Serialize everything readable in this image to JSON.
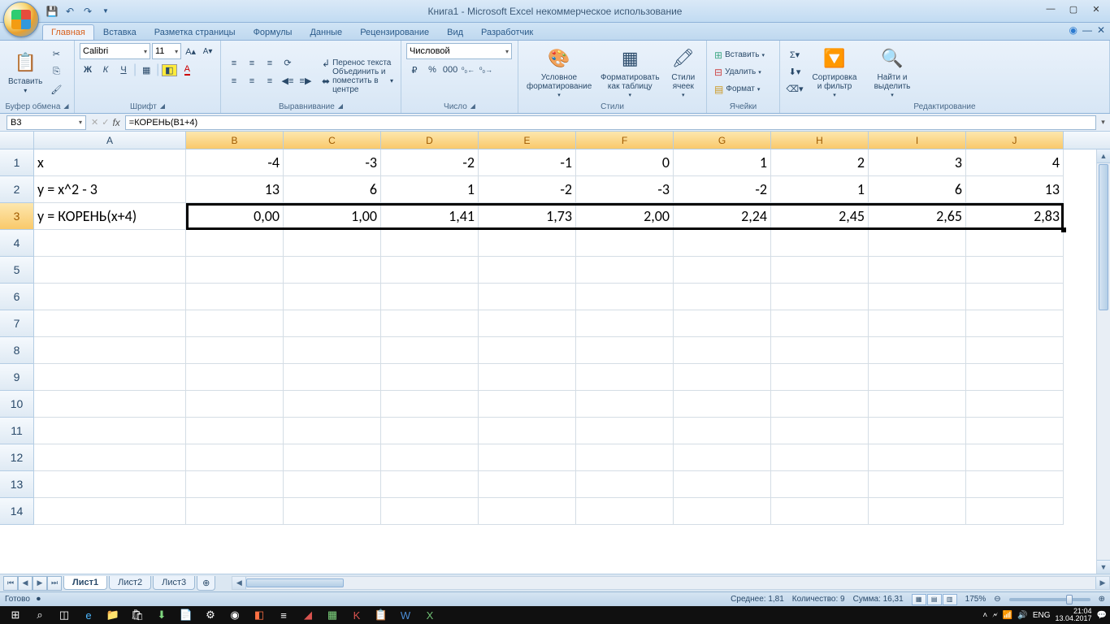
{
  "title": "Книга1 - Microsoft Excel некоммерческое использование",
  "ribbon": {
    "tabs": [
      "Главная",
      "Вставка",
      "Разметка страницы",
      "Формулы",
      "Данные",
      "Рецензирование",
      "Вид",
      "Разработчик"
    ],
    "active_tab": "Главная",
    "clipboard": {
      "label": "Буфер обмена",
      "paste": "Вставить"
    },
    "font": {
      "label": "Шрифт",
      "name": "Calibri",
      "size": "11",
      "bold": "Ж",
      "italic": "К",
      "underline": "Ч"
    },
    "alignment": {
      "label": "Выравнивание",
      "wrap": "Перенос текста",
      "merge": "Объединить и поместить в центре"
    },
    "number": {
      "label": "Число",
      "format": "Числовой"
    },
    "styles": {
      "label": "Стили",
      "cond": "Условное форматирование",
      "table": "Форматировать как таблицу",
      "cell": "Стили ячеек"
    },
    "cells": {
      "label": "Ячейки",
      "insert": "Вставить",
      "delete": "Удалить",
      "format": "Формат"
    },
    "editing": {
      "label": "Редактирование",
      "sort": "Сортировка и фильтр",
      "find": "Найти и выделить"
    }
  },
  "formula_bar": {
    "name_box": "B3",
    "formula": "=КОРЕНЬ(B1+4)"
  },
  "columns": [
    "A",
    "B",
    "C",
    "D",
    "E",
    "F",
    "G",
    "H",
    "I",
    "J"
  ],
  "row_numbers": [
    "1",
    "2",
    "3",
    "4",
    "5",
    "6",
    "7",
    "8",
    "9",
    "10",
    "11",
    "12",
    "13",
    "14"
  ],
  "grid": {
    "r1": {
      "A": "x",
      "B": "-4",
      "C": "-3",
      "D": "-2",
      "E": "-1",
      "F": "0",
      "G": "1",
      "H": "2",
      "I": "3",
      "J": "4"
    },
    "r2": {
      "A": "y = x^2 - 3",
      "B": "13",
      "C": "6",
      "D": "1",
      "E": "-2",
      "F": "-3",
      "G": "-2",
      "H": "1",
      "I": "6",
      "J": "13"
    },
    "r3": {
      "A": "y = КОРЕНЬ(x+4)",
      "B": "0,00",
      "C": "1,00",
      "D": "1,41",
      "E": "1,73",
      "F": "2,00",
      "G": "2,24",
      "H": "2,45",
      "I": "2,65",
      "J": "2,83"
    }
  },
  "sheets": {
    "s1": "Лист1",
    "s2": "Лист2",
    "s3": "Лист3"
  },
  "status": {
    "ready": "Готово",
    "avg": "Среднее: 1,81",
    "count": "Количество: 9",
    "sum": "Сумма: 16,31",
    "zoom": "175%"
  },
  "taskbar": {
    "lang": "ENG",
    "time": "21:04",
    "date": "13.04.2017"
  }
}
